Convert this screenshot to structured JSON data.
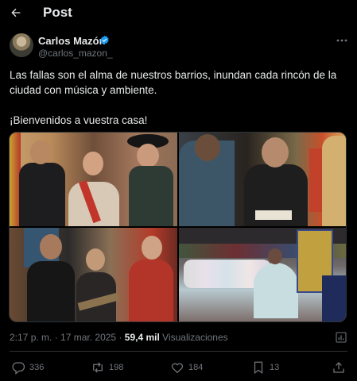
{
  "header": {
    "title": "Post",
    "back_icon": "arrow-left-icon"
  },
  "author": {
    "name": "Carlos Mazón",
    "handle": "@carlos_mazon_",
    "verified": true,
    "verified_color": "#1d9bf0"
  },
  "tweet": {
    "paragraph_1": "Las fallas son el alma de nuestros barrios, inundan cada rincón de la ciudad con música y ambiente.",
    "paragraph_2": "¡Bienvenidos a vuestra casa!"
  },
  "meta": {
    "time": "2:17 p. m.",
    "separator": " · ",
    "date": "17 mar. 2025",
    "views_count": "59,4 mil",
    "views_label": "Visualizaciones"
  },
  "actions": {
    "replies": "336",
    "reposts": "198",
    "likes": "184",
    "bookmarks": "13"
  },
  "colors": {
    "background": "#000000",
    "text": "#e7e9ea",
    "secondary_text": "#71767b",
    "divider": "#2f3336"
  }
}
